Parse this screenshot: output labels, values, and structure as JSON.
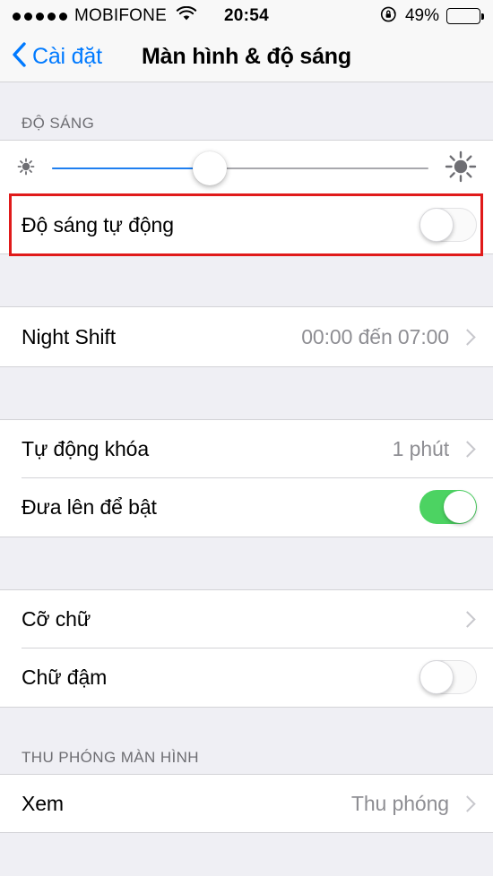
{
  "status_bar": {
    "signal_dots": 5,
    "carrier": "MOBIFONE",
    "wifi_icon": "wifi-icon",
    "time": "20:54",
    "rotation_lock_icon": "rotation-lock-icon",
    "battery_percent": "49%",
    "battery_level": 49
  },
  "nav": {
    "back_label": "Cài đặt",
    "back_icon": "chevron-left-icon",
    "title": "Màn hình & độ sáng"
  },
  "sections": {
    "brightness": {
      "header": "ĐỘ SÁNG",
      "slider": {
        "name": "brightness-slider",
        "value": 42,
        "min_icon": "sun-small-icon",
        "max_icon": "sun-large-icon",
        "fill_color": "#1f7ff0",
        "track_color": "#a8a8ad"
      },
      "auto_brightness": {
        "label": "Độ sáng tự động",
        "toggle_state": "off"
      }
    },
    "night_shift": {
      "label": "Night Shift",
      "value": "00:00 đến 07:00",
      "chevron_icon": "chevron-right-icon"
    },
    "lock": {
      "auto_lock": {
        "label": "Tự động khóa",
        "value": "1 phút",
        "chevron_icon": "chevron-right-icon"
      },
      "raise_to_wake": {
        "label": "Đưa lên để bật",
        "toggle_state": "on"
      }
    },
    "text": {
      "text_size": {
        "label": "Cỡ chữ",
        "chevron_icon": "chevron-right-icon"
      },
      "bold_text": {
        "label": "Chữ đậm",
        "toggle_state": "off"
      }
    },
    "display_zoom": {
      "header": "THU PHÓNG MÀN HÌNH",
      "view": {
        "label": "Xem",
        "value": "Thu phóng",
        "chevron_icon": "chevron-right-icon"
      }
    }
  },
  "annotation": {
    "color": "#e01a1a",
    "target": "auto-brightness-row"
  }
}
